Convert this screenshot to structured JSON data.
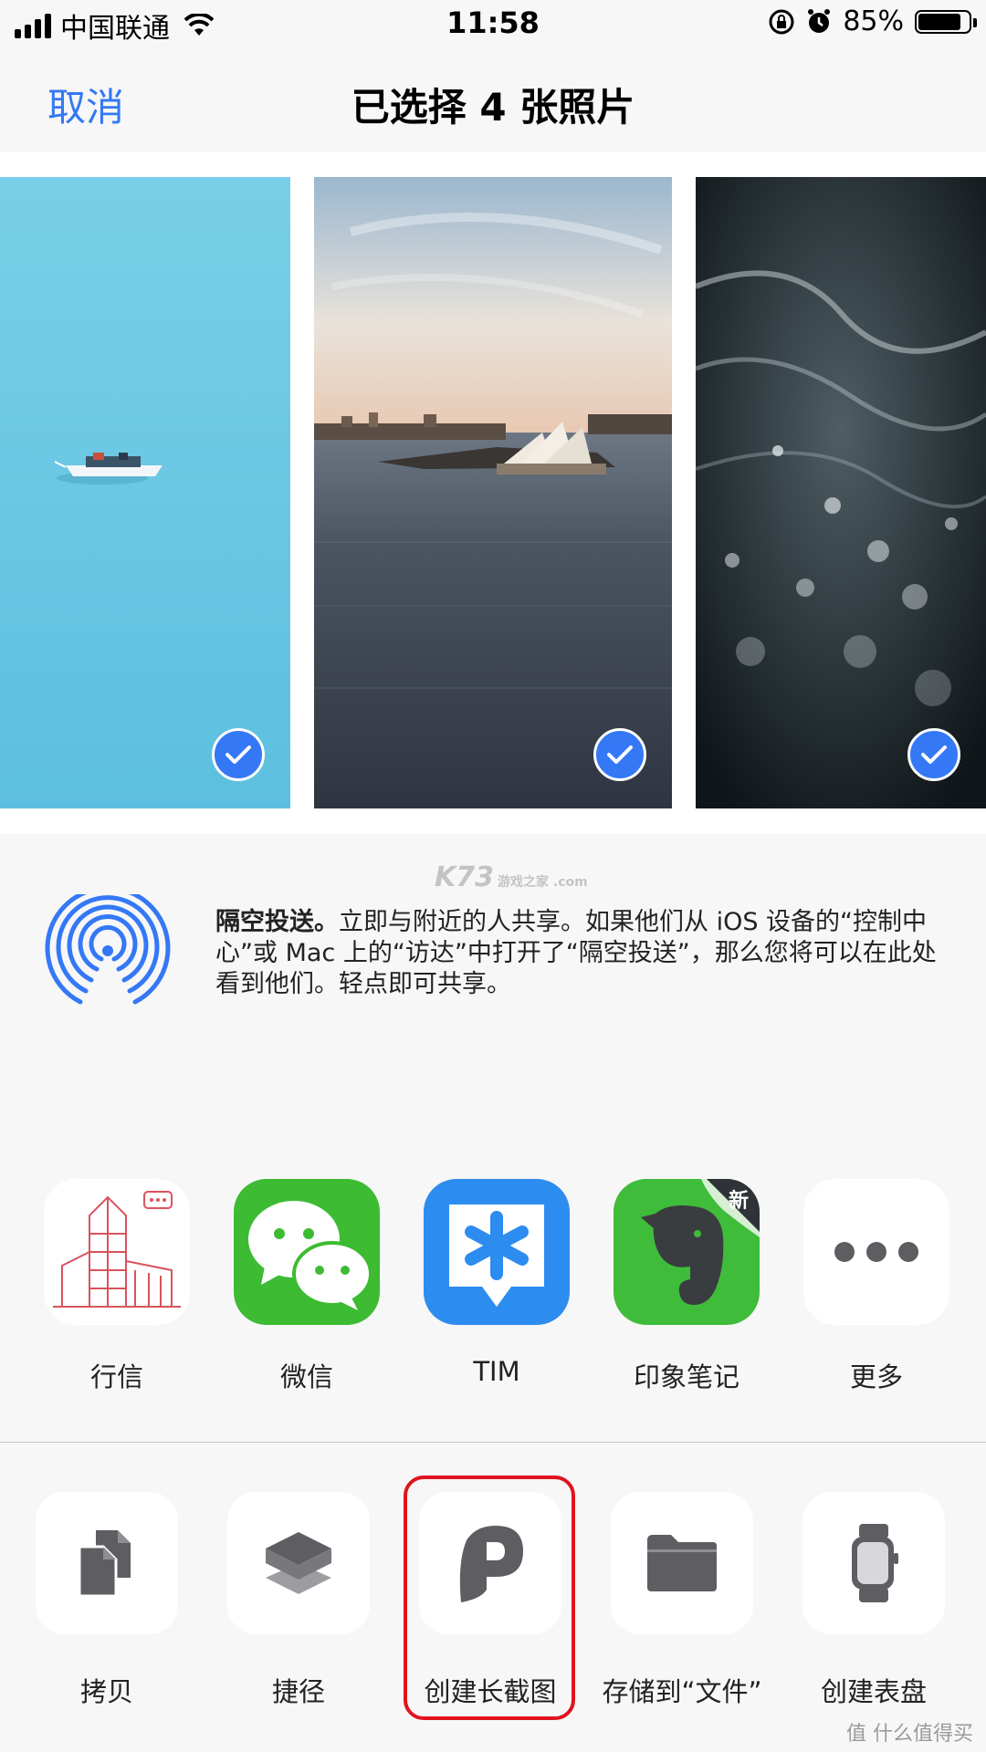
{
  "status_bar": {
    "carrier": "中国联通",
    "time": "11:58",
    "battery_percent_text": "85%",
    "battery_level": 0.85
  },
  "nav": {
    "cancel_label": "取消",
    "title": "已选择 4 张照片"
  },
  "photos": [
    {
      "name": "boat-on-blue-water",
      "selected": true
    },
    {
      "name": "sydney-opera-house-harbour",
      "selected": true
    },
    {
      "name": "dark-water-waves",
      "selected": true
    }
  ],
  "airdrop": {
    "title": "隔空投送。",
    "description": "立即与附近的人共享。如果他们从 iOS 设备的“控制中心”或 Mac 上的“访达”中打开了“隔空投送”，那么您将可以在此处看到他们。轻点即可共享。",
    "watermark": "K73",
    "watermark_sub": "游戏之家 .com"
  },
  "apps": [
    {
      "label": "行信",
      "icon": "building-sketch-icon"
    },
    {
      "label": "微信",
      "icon": "wechat-icon"
    },
    {
      "label": "TIM",
      "icon": "tim-icon"
    },
    {
      "label": "印象笔记",
      "icon": "evernote-icon",
      "badge": "新"
    },
    {
      "label": "更多",
      "icon": "more-icon"
    }
  ],
  "actions": [
    {
      "label": "拷贝",
      "icon": "copy-icon"
    },
    {
      "label": "捷径",
      "icon": "shortcuts-icon"
    },
    {
      "label": "创建长截图",
      "icon": "picsew-icon",
      "highlighted": true
    },
    {
      "label": "存储到“文件”",
      "icon": "folder-icon"
    },
    {
      "label": "创建表盘",
      "icon": "watch-icon"
    }
  ],
  "colors": {
    "accent": "#3478f6",
    "highlight": "#e0141e",
    "wechat": "#3dbb33",
    "tim": "#2d8cf0",
    "evernote": "#3fbc3a"
  },
  "corner_watermark": "值 什么值得买"
}
